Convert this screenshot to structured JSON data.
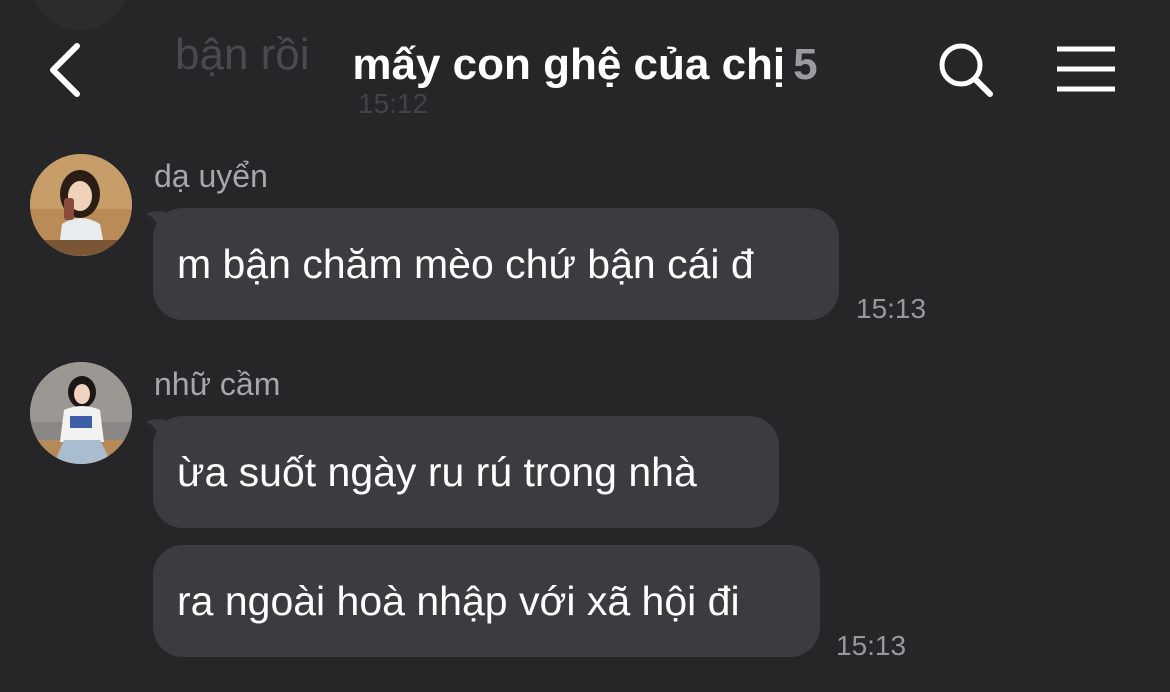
{
  "header": {
    "title": "mấy con ghệ của chị",
    "member_count": "5",
    "icons": {
      "back": "chevron-left-icon",
      "search": "search-icon",
      "menu": "hamburger-menu-icon"
    }
  },
  "previous_message": {
    "text": "bận rồi",
    "time": "15:12"
  },
  "messages": [
    {
      "sender": "dạ uyển",
      "bubbles": [
        "m bận chăm mèo chứ bận cái đ"
      ],
      "time": "15:13"
    },
    {
      "sender": "nhữ cầm",
      "bubbles": [
        "ừa suốt ngày ru rú trong nhà",
        "ra ngoài hoà nhập với xã hội đi"
      ],
      "time": "15:13"
    }
  ],
  "colors": {
    "background": "#262629",
    "bubble": "#3c3c40",
    "sender_text": "#a7a7ab",
    "timestamp": "#97979c"
  }
}
